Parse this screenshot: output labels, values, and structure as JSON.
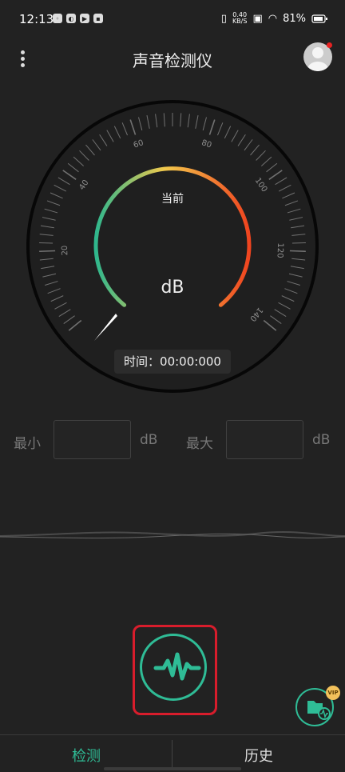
{
  "status_bar": {
    "time": "12:13",
    "net_speed_value": "0.40",
    "net_speed_unit": "KB/S",
    "battery": "81%",
    "icons": [
      "notification-app-icon",
      "browser-app-icon",
      "video-app-icon",
      "message-app-icon",
      "vibrate-icon",
      "sim-icon",
      "wifi-icon",
      "battery-icon"
    ]
  },
  "header": {
    "title": "声音检测仪",
    "menu_icon": "more-vertical-icon",
    "avatar_icon": "user-avatar-icon"
  },
  "gauge": {
    "current_label": "当前",
    "unit": "dB",
    "ticks": [
      "20",
      "40",
      "60",
      "80",
      "100",
      "120",
      "140"
    ],
    "needle_value": 0,
    "colors": {
      "start": "#2fb78d",
      "mid": "#f2c94c",
      "end": "#f0441f"
    }
  },
  "timer": {
    "text": "时间：00:00:000"
  },
  "stats": {
    "min_label": "最小",
    "min_value": "",
    "min_unit": "dB",
    "max_label": "最大",
    "max_value": "",
    "max_unit": "dB"
  },
  "record": {
    "icon": "waveform-icon",
    "accent": "#2fbc96",
    "highlight": "#d81d2c"
  },
  "files": {
    "icon": "folder-waveform-icon",
    "badge": "VIP"
  },
  "bottom_nav": {
    "tabs": [
      {
        "label": "检测",
        "active": true
      },
      {
        "label": "历史",
        "active": false
      }
    ],
    "active_color": "#2fbc96",
    "inactive_color": "#dddddd"
  }
}
